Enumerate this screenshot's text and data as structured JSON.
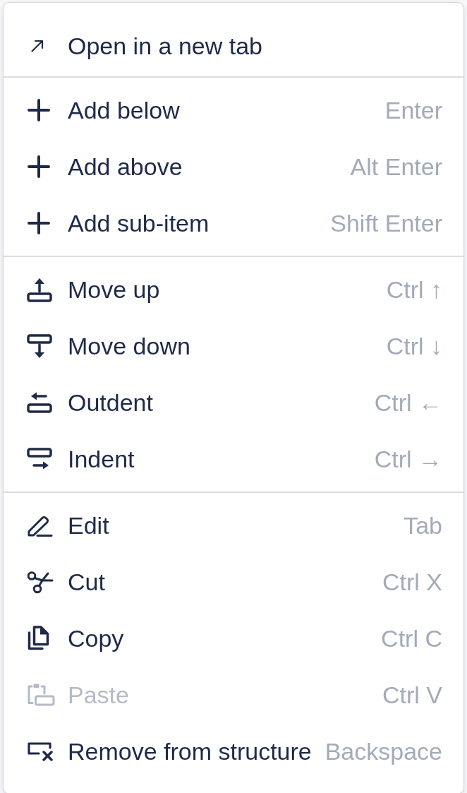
{
  "context_menu": {
    "sections": [
      {
        "items": [
          {
            "label": "Open in a new tab",
            "disabled": false
          }
        ]
      },
      {
        "items": [
          {
            "label": "Add below",
            "shortcut": "Enter",
            "disabled": false
          },
          {
            "label": "Add above",
            "shortcut": "Alt Enter",
            "disabled": false
          },
          {
            "label": "Add sub-item",
            "shortcut": "Shift Enter",
            "disabled": false
          }
        ]
      },
      {
        "items": [
          {
            "label": "Move up",
            "shortcut": "Ctrl ↑",
            "disabled": false
          },
          {
            "label": "Move down",
            "shortcut": "Ctrl ↓",
            "disabled": false
          },
          {
            "label": "Outdent",
            "shortcut": "Ctrl ←",
            "disabled": false
          },
          {
            "label": "Indent",
            "shortcut": "Ctrl →",
            "disabled": false
          }
        ]
      },
      {
        "items": [
          {
            "label": "Edit",
            "shortcut": "Tab",
            "disabled": false
          },
          {
            "label": "Cut",
            "shortcut": "Ctrl X",
            "disabled": false
          },
          {
            "label": "Copy",
            "shortcut": "Ctrl C",
            "disabled": false
          },
          {
            "label": "Paste",
            "shortcut": "Ctrl V",
            "disabled": true
          },
          {
            "label": "Remove from structure",
            "shortcut": "Backspace",
            "disabled": false
          }
        ]
      }
    ]
  }
}
